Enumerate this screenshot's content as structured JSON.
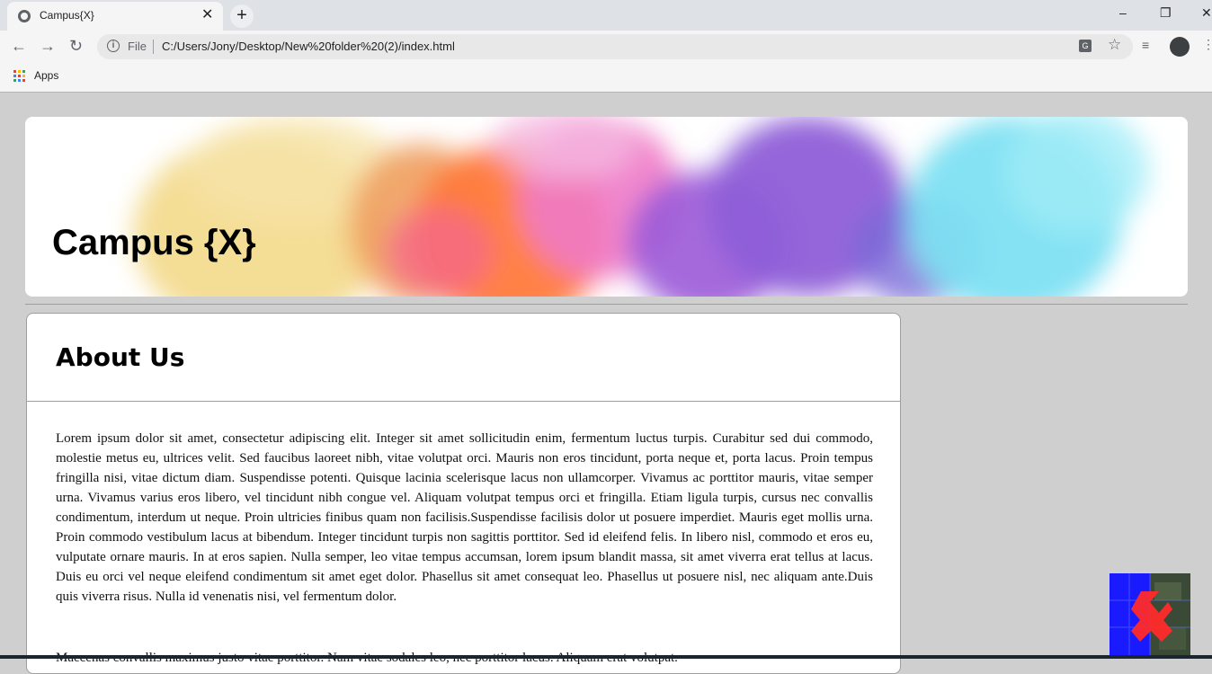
{
  "browser": {
    "tab_title": "Campus{X}",
    "tab_close": "✕",
    "new_tab": "+",
    "window_controls": {
      "minimize": "–",
      "restore": "❐",
      "close": "✕"
    },
    "nav": {
      "back": "←",
      "forward": "→",
      "reload": "↻"
    },
    "address": {
      "scheme_label": "File",
      "url": "C:/Users/Jony/Desktop/New%20folder%20(2)/index.html"
    },
    "bookmarks": {
      "apps_label": "Apps"
    }
  },
  "page": {
    "banner_title": "Campus {X}",
    "about": {
      "heading": "About Us",
      "paragraph1": "Lorem ipsum dolor sit amet, consectetur adipiscing elit. Integer sit amet sollicitudin enim, fermentum luctus turpis. Curabitur sed dui commodo, molestie metus eu, ultrices velit. Sed faucibus laoreet nibh, vitae volutpat orci. Mauris non eros tincidunt, porta neque et, porta lacus. Proin tempus fringilla nisi, vitae dictum diam. Suspendisse potenti. Quisque lacinia scelerisque lacus non ullamcorper. Vivamus ac porttitor mauris, vitae semper urna. Vivamus varius eros libero, vel tincidunt nibh congue vel. Aliquam volutpat tempus orci et fringilla. Etiam ligula turpis, cursus nec convallis condimentum, interdum ut neque. Proin ultricies finibus quam non facilisis.Suspendisse facilisis dolor ut posuere imperdiet. Mauris eget mollis urna. Proin commodo vestibulum lacus at bibendum. Integer tincidunt turpis non sagittis porttitor. Sed id eleifend felis. In libero nisl, commodo et eros eu, vulputate ornare mauris. In at eros sapien. Nulla semper, leo vitae tempus accumsan, lorem ipsum blandit massa, sit amet viverra erat tellus at lacus. Duis eu orci vel neque eleifend condimentum sit amet eget dolor. Phasellus sit amet consequat leo. Phasellus ut posuere nisl, nec aliquam ante.Duis quis viverra risus. Nulla id venenatis nisi, vel fermentum dolor.",
      "paragraph2": "Maecenas convallis maximus justo vitae porttitor. Nam vitae sodales leo, nec porttitor lacus. Aliquam erat volutpat."
    }
  },
  "colors": {
    "page_bg": "#cfcfcf",
    "splash": [
      "#f3d98a",
      "#ff7a3d",
      "#f07ac8",
      "#8e5ed8",
      "#7de0f2"
    ]
  },
  "icons": [
    "globe-icon",
    "info-icon",
    "translate-icon",
    "star-icon",
    "media-icon",
    "apps-icon",
    "menu-icon"
  ]
}
